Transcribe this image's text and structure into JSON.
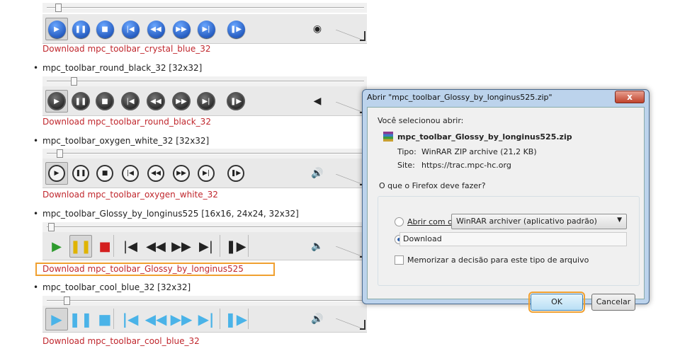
{
  "toolbars": [
    {
      "id": "crystal-blue",
      "theme": "crystal",
      "title": null,
      "link": "Download mpc_toolbar_crystal_blue_32",
      "volume_icon": "speaker-icon",
      "volume_glyph": "◉"
    },
    {
      "id": "round-black",
      "theme": "black",
      "title": "mpc_toolbar_round_black_32 [32x32]",
      "link": "Download mpc_toolbar_round_black_32",
      "volume_icon": "speaker-icon",
      "volume_glyph": "◀"
    },
    {
      "id": "oxygen-white",
      "theme": "oxygen",
      "title": "mpc_toolbar_oxygen_white_32 [32x32]",
      "link": "Download mpc_toolbar_oxygen_white_32",
      "volume_icon": "speaker-icon",
      "volume_glyph": "🔊"
    },
    {
      "id": "glossy",
      "theme": "glossy",
      "title": "mpc_toolbar_Glossy_by_longinus525 [16x16, 24x24, 32x32]",
      "link": "Download mpc_toolbar_Glossy_by_longinus525",
      "volume_icon": "speaker-icon",
      "volume_glyph": "🔈"
    },
    {
      "id": "cool-blue",
      "theme": "cool",
      "title": "mpc_toolbar_cool_blue_32 [32x32]",
      "link": "Download mpc_toolbar_cool_blue_32",
      "volume_icon": "speaker-icon",
      "volume_glyph": "🔊"
    }
  ],
  "buttons": [
    {
      "name": "play",
      "glyph": "▶"
    },
    {
      "name": "pause",
      "glyph": "❚❚"
    },
    {
      "name": "stop",
      "glyph": "■"
    },
    {
      "name": "previous",
      "glyph": "|◀"
    },
    {
      "name": "rewind",
      "glyph": "◀◀"
    },
    {
      "name": "fast-forward",
      "glyph": "▶▶"
    },
    {
      "name": "next",
      "glyph": "▶|"
    },
    {
      "name": "frame-step",
      "glyph": "❚▶"
    }
  ],
  "dialog": {
    "title": "Abrir \"mpc_toolbar_Glossy_by_longinus525.zip\"",
    "close": "x",
    "intro": "Você selecionou abrir:",
    "filename": "mpc_toolbar_Glossy_by_longinus525.zip",
    "type_label": "Tipo:",
    "type_value": "WinRAR ZIP archive (21,2 KB)",
    "site_label": "Site:",
    "site_value": "https://trac.mpc-hc.org",
    "group_label": "O que o Firefox deve fazer?",
    "open_with_label": "Abrir com o:",
    "open_with_value": "WinRAR archiver (aplicativo padrão)",
    "download_label": "Download",
    "remember_label": "Memorizar a decisão para este tipo de arquivo",
    "ok": "OK",
    "cancel": "Cancelar"
  }
}
